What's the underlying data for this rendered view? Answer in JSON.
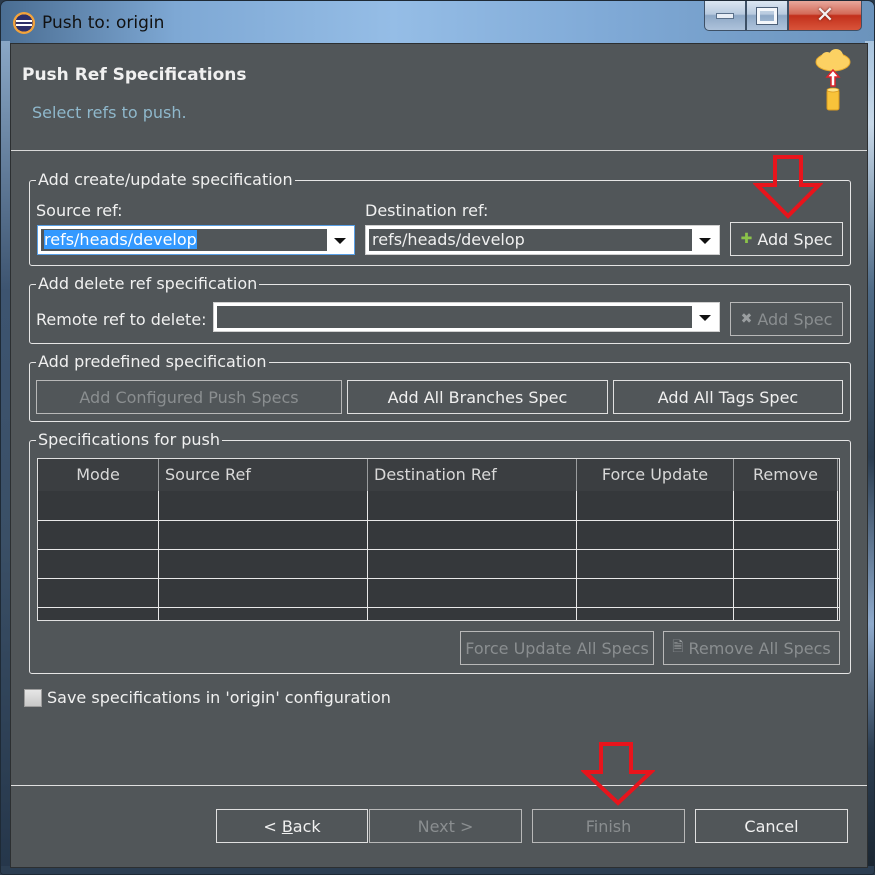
{
  "window": {
    "title": "Push to: origin",
    "minimize_label": "Minimize",
    "maximize_label": "Maximize",
    "close_label": "Close"
  },
  "header": {
    "title": "Push Ref Specifications",
    "subtitle": "Select refs to push.",
    "icon": "cloud-upload-icon"
  },
  "create_update": {
    "group_label": "Add create/update specification",
    "source_label": "Source ref:",
    "source_value": "refs/heads/develop",
    "destination_label": "Destination ref:",
    "destination_value": "refs/heads/develop",
    "add_spec_label": "Add Spec",
    "add_spec_icon": "plus-icon"
  },
  "delete_ref": {
    "group_label": "Add delete ref specification",
    "remote_label": "Remote ref to delete:",
    "remote_value": "",
    "add_spec_label": "Add Spec",
    "add_spec_icon": "delete-x-icon",
    "add_spec_enabled": false
  },
  "predefined": {
    "group_label": "Add predefined specification",
    "buttons": [
      {
        "label": "Add Configured Push Specs",
        "enabled": false
      },
      {
        "label": "Add All Branches Spec",
        "enabled": true
      },
      {
        "label": "Add All Tags Spec",
        "enabled": true
      }
    ]
  },
  "specs": {
    "group_label": "Specifications for push",
    "columns": [
      "Mode",
      "Source Ref",
      "Destination Ref",
      "Force Update",
      "Remove"
    ],
    "rows": [],
    "force_update_all_label": "Force Update All Specs",
    "remove_all_label": "Remove All Specs",
    "force_update_all_enabled": false,
    "remove_all_enabled": false
  },
  "save_config": {
    "label": "Save specifications in 'origin' configuration",
    "checked": false
  },
  "footer": {
    "back_label": "< Back",
    "back_mnemonic": "B",
    "next_label": "Next >",
    "finish_label": "Finish",
    "cancel_label": "Cancel",
    "next_enabled": false,
    "finish_enabled": false
  },
  "annotations": {
    "color": "#e8141c",
    "targets": [
      "create-update-add-spec-button",
      "finish-button"
    ]
  }
}
